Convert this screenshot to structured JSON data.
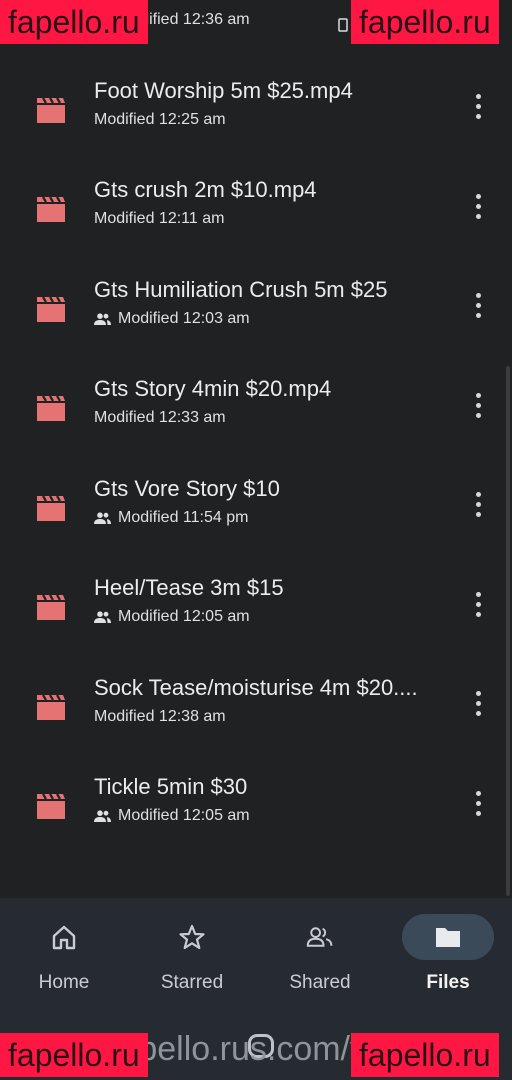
{
  "watermark": {
    "text": "fapello.ru",
    "url": "fapello.rus.com/vi0"
  },
  "colors": {
    "file_icon": "#e57373",
    "background": "#1f2123",
    "nav_bg": "#262b31",
    "active_pill": "#3b4a58"
  },
  "files": [
    {
      "name": "",
      "modified": "Modified 12:36 am",
      "shared": true
    },
    {
      "name": "Foot Worship 5m $25.mp4",
      "modified": "Modified 12:25 am",
      "shared": false
    },
    {
      "name": "Gts crush 2m $10.mp4",
      "modified": "Modified 12:11 am",
      "shared": false
    },
    {
      "name": "Gts Humiliation Crush 5m $25",
      "modified": "Modified 12:03 am",
      "shared": true
    },
    {
      "name": "Gts Story 4min $20.mp4",
      "modified": "Modified 12:33 am",
      "shared": false
    },
    {
      "name": "Gts Vore Story $10",
      "modified": "Modified 11:54 pm",
      "shared": true
    },
    {
      "name": "Heel/Tease 3m $15",
      "modified": "Modified 12:05 am",
      "shared": true
    },
    {
      "name": "Sock Tease/moisturise 4m $20....",
      "modified": "Modified 12:38 am",
      "shared": false
    },
    {
      "name": "Tickle 5min $30",
      "modified": "Modified 12:05 am",
      "shared": true
    }
  ],
  "nav": [
    {
      "label": "Home",
      "icon": "home-icon",
      "active": false
    },
    {
      "label": "Starred",
      "icon": "star-icon",
      "active": false
    },
    {
      "label": "Shared",
      "icon": "shared-icon",
      "active": false
    },
    {
      "label": "Files",
      "icon": "folder-icon",
      "active": true
    }
  ]
}
